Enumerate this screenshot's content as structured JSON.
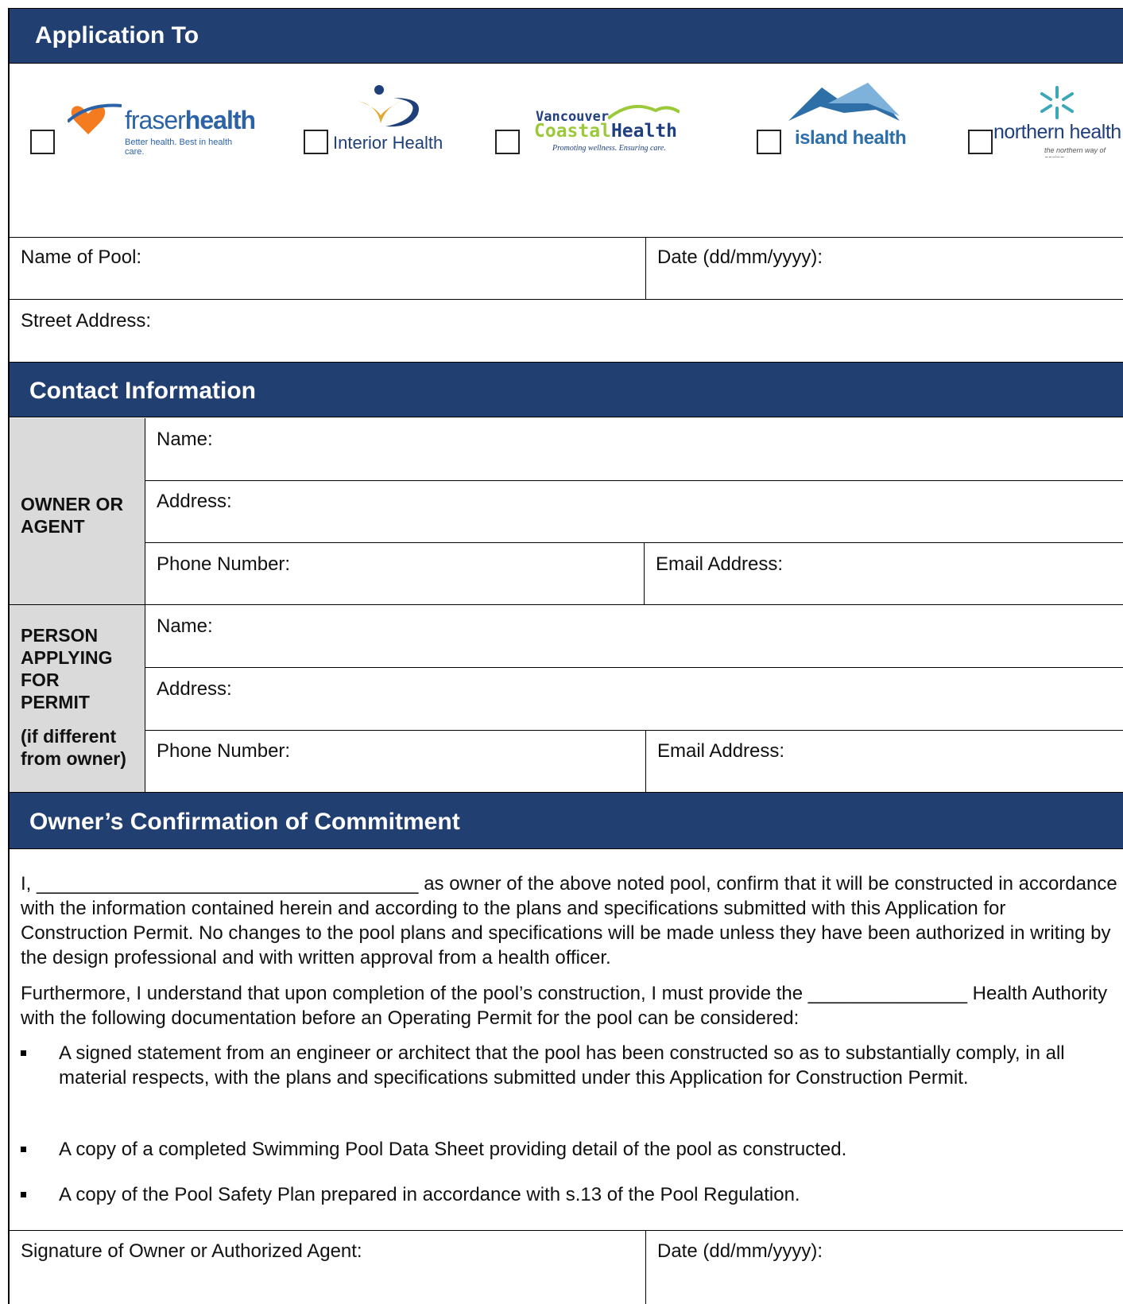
{
  "sections": {
    "application_to": "Application To",
    "contact_info": "Contact Information",
    "commitment": "Owner’s Confirmation of Commitment"
  },
  "health_authorities": [
    {
      "name": "fraserhealth",
      "name_a": "fraser",
      "name_b": "health",
      "tagline": "Better health. Best in health care.",
      "checked": false
    },
    {
      "name": "Interior Health",
      "checked": false
    },
    {
      "name_a": "Vancouver",
      "name_b": "Coastal",
      "name_c": "Health",
      "tagline": "Promoting wellness. Ensuring care.",
      "checked": false
    },
    {
      "name": "island health",
      "checked": false
    },
    {
      "name": "northern health",
      "tagline": "the northern way of caring",
      "checked": false
    }
  ],
  "pool_fields": {
    "name_of_pool": "Name of Pool:",
    "date": "Date (dd/mm/yyyy):",
    "street_address": "Street Address:"
  },
  "owner": {
    "label": "OWNER OR AGENT",
    "name": "Name:",
    "address": "Address:",
    "phone": "Phone Number:",
    "email": "Email Address:"
  },
  "applicant": {
    "label": "PERSON APPLYING FOR PERMIT",
    "sublabel": "(if different from owner)",
    "name": "Name:",
    "address": "Address:",
    "phone": "Phone Number:",
    "email": "Email Address:"
  },
  "commitment": {
    "para1": "I, ____________________________________ as owner of the above noted pool, confirm that it will be constructed in accordance with the information contained herein and according to the plans and specifications submitted with this Application for Construction Permit. No changes to the pool plans and specifications will be made unless they have been authorized in writing by the design professional and with written approval from a health officer.",
    "para2": "Furthermore, I understand that upon completion of the pool’s construction, I must provide the _______________ Health Authority with the following documentation before an Operating Permit for the pool can be considered:",
    "bullets": [
      "A signed statement from an engineer or architect that the pool has been constructed so as to substantially comply, in all material respects, with the plans and specifications submitted under this Application for Construction Permit.",
      "A copy of a completed Swimming Pool Data Sheet providing detail of the pool as constructed.",
      "A copy of the Pool Safety Plan prepared in accordance with s.13 of the Pool Regulation."
    ]
  },
  "signature": {
    "label": "Signature of Owner or Authorized Agent:",
    "date": "Date (dd/mm/yyyy):"
  },
  "colors": {
    "header_bg": "#223F72",
    "header_text": "#FFFFFF",
    "label_bg": "#DADADA"
  }
}
